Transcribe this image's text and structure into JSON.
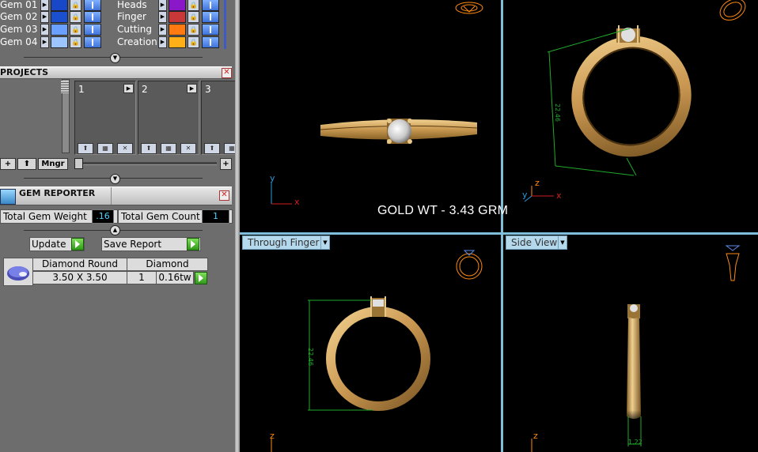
{
  "layers": {
    "left": [
      {
        "name": "Gem 01",
        "color": "#1848c8"
      },
      {
        "name": "Gem 02",
        "color": "#1a4fd0"
      },
      {
        "name": "Gem 03",
        "color": "#6aa0ff"
      },
      {
        "name": "Gem 04",
        "color": "#9cc4ff"
      }
    ],
    "right": [
      {
        "name": "Heads",
        "color": "#8a18c8"
      },
      {
        "name": "Finger",
        "color": "#c83838"
      },
      {
        "name": "Cutting",
        "color": "#ff7a10"
      },
      {
        "name": "Creation",
        "color": "#ffb018"
      }
    ]
  },
  "projects": {
    "title": "PROJECTS",
    "slots": [
      "1",
      "2",
      "3"
    ],
    "mngr_label": "Mngr"
  },
  "gem_reporter": {
    "title": "GEM REPORTER",
    "total_weight_label": "Total Gem Weight",
    "total_weight_value": ".16",
    "total_count_label": "Total Gem Count",
    "total_count_value": "1",
    "update_label": "Update",
    "save_label": "Save Report",
    "gem": {
      "shape": "Diamond Round",
      "material": "Diamond",
      "size": "3.50 X 3.50",
      "count": "1",
      "weight": "0.16tw"
    }
  },
  "viewports": {
    "bottom_left_label": "Through Finger",
    "bottom_right_label": "Side View",
    "dim_value": "22.46",
    "dim_value_side": "1.22"
  },
  "overlay": {
    "gold_weight": "GOLD WT - 3.43 GRM"
  },
  "axes": {
    "x": "x",
    "y": "y",
    "z": "z"
  },
  "colors": {
    "gold": "#d8aa62",
    "viewport_bg": "#000000",
    "axis_x": "#d02020",
    "axis_y": "#2a9ad8",
    "dim_line": "#1faa2a"
  }
}
